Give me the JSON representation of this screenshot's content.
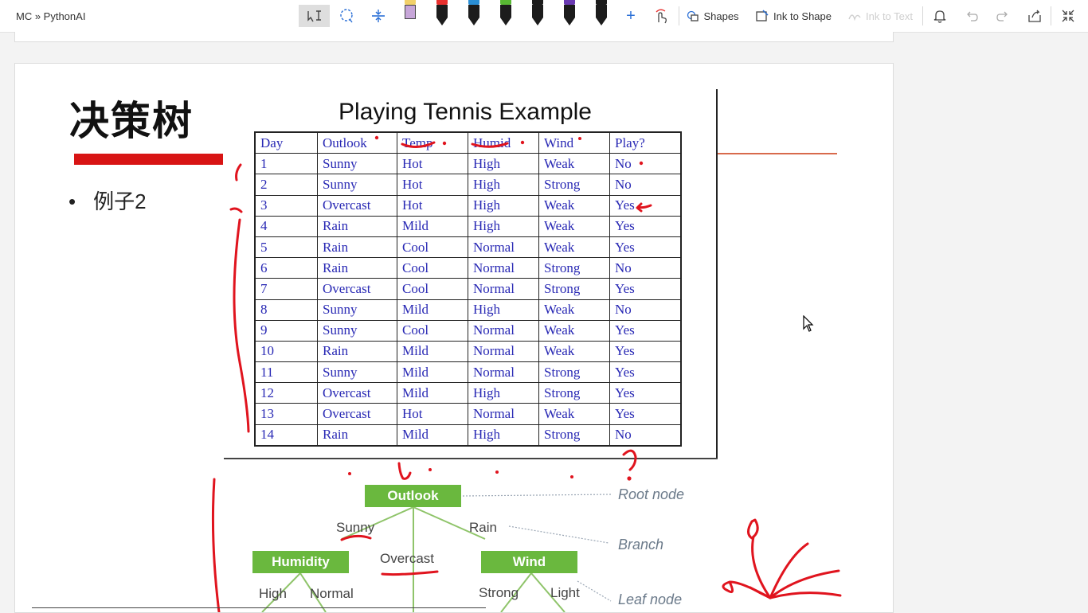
{
  "app": {
    "breadcrumb": "MC » PythonAI"
  },
  "toolbar": {
    "shapes_label": "Shapes",
    "ink_to_shape_label": "Ink to Shape",
    "ink_to_text_label": "Ink to Text",
    "pen_colors": [
      "#c7a6d9",
      "#e8302e",
      "#2a8fd6",
      "#58b833",
      "#1c1c1c",
      "#6a3ab2",
      "#1c1c1c"
    ],
    "pen_caps": [
      "#f2d16b",
      "#e8302e",
      "#2a8fd6",
      "#58b833",
      "#1c1c1c",
      "#6a3ab2",
      "#1c1c1c"
    ]
  },
  "slide": {
    "title": "决策树",
    "bullet": "例子2",
    "table_title": "Playing Tennis Example",
    "table": {
      "headers": [
        "Day",
        "Outlook",
        "Temp",
        "Humid",
        "Wind",
        "Play?"
      ],
      "rows": [
        [
          "1",
          "Sunny",
          "Hot",
          "High",
          "Weak",
          "No"
        ],
        [
          "2",
          "Sunny",
          "Hot",
          "High",
          "Strong",
          "No"
        ],
        [
          "3",
          "Overcast",
          "Hot",
          "High",
          "Weak",
          "Yes"
        ],
        [
          "4",
          "Rain",
          "Mild",
          "High",
          "Weak",
          "Yes"
        ],
        [
          "5",
          "Rain",
          "Cool",
          "Normal",
          "Weak",
          "Yes"
        ],
        [
          "6",
          "Rain",
          "Cool",
          "Normal",
          "Strong",
          "No"
        ],
        [
          "7",
          "Overcast",
          "Cool",
          "Normal",
          "Strong",
          "Yes"
        ],
        [
          "8",
          "Sunny",
          "Mild",
          "High",
          "Weak",
          "No"
        ],
        [
          "9",
          "Sunny",
          "Cool",
          "Normal",
          "Weak",
          "Yes"
        ],
        [
          "10",
          "Rain",
          "Mild",
          "Normal",
          "Weak",
          "Yes"
        ],
        [
          "11",
          "Sunny",
          "Mild",
          "Normal",
          "Strong",
          "Yes"
        ],
        [
          "12",
          "Overcast",
          "Mild",
          "High",
          "Strong",
          "Yes"
        ],
        [
          "13",
          "Overcast",
          "Hot",
          "Normal",
          "Weak",
          "Yes"
        ],
        [
          "14",
          "Rain",
          "Mild",
          "High",
          "Strong",
          "No"
        ]
      ]
    },
    "tree": {
      "root": "Outlook",
      "left_node": "Humidity",
      "right_node": "Wind",
      "branch_sunny": "Sunny",
      "branch_overcast": "Overcast",
      "branch_rain": "Rain",
      "branch_high": "High",
      "branch_normal": "Normal",
      "branch_strong": "Strong",
      "branch_light": "Light",
      "ann_root": "Root node",
      "ann_branch": "Branch",
      "ann_leaf": "Leaf node"
    }
  },
  "colors": {
    "ink": "#e0141e",
    "node": "#6ab83e",
    "table_text": "#2828b4",
    "title_bar": "#d81414"
  }
}
